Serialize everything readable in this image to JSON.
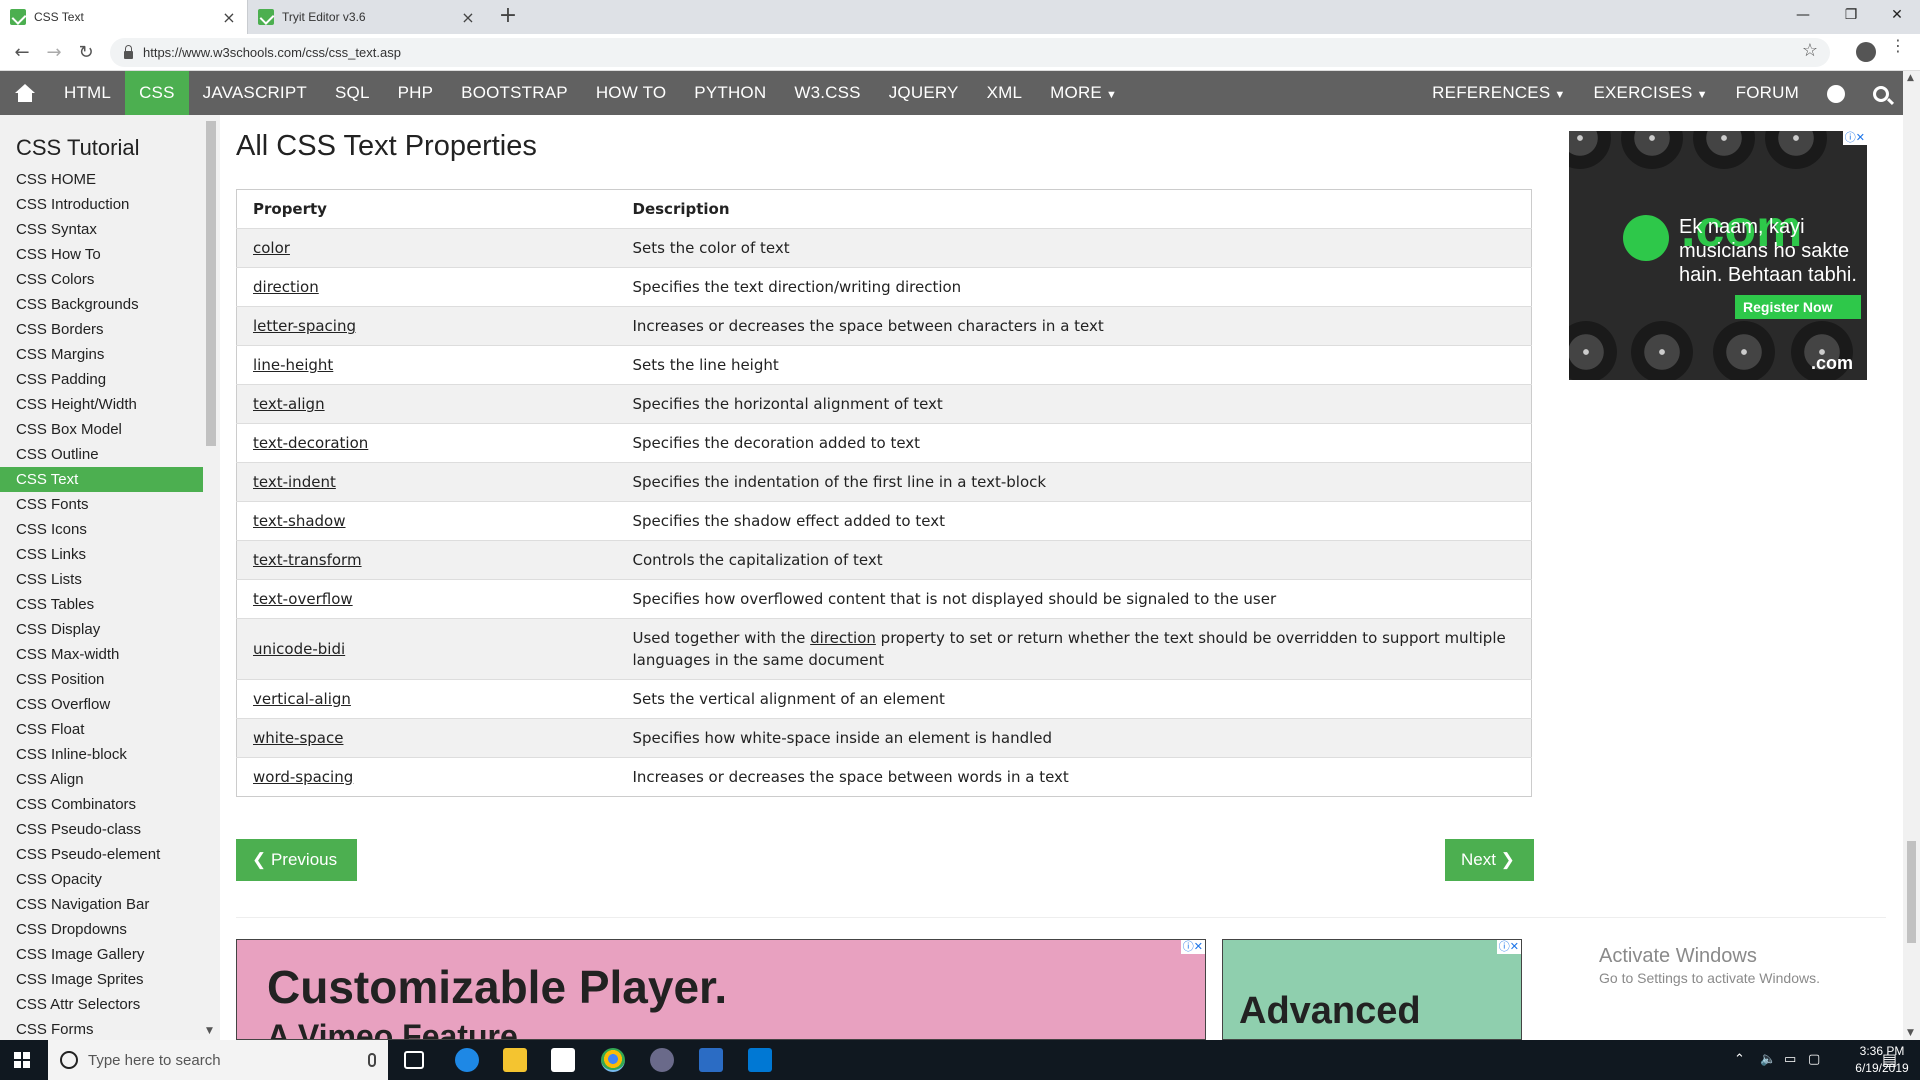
{
  "browser": {
    "tabs": [
      {
        "title": "CSS Text",
        "active": true
      },
      {
        "title": "Tryit Editor v3.6",
        "active": false
      }
    ],
    "url": "https://www.w3schools.com/css/css_text.asp"
  },
  "topnav": {
    "items": [
      "HTML",
      "CSS",
      "JAVASCRIPT",
      "SQL",
      "PHP",
      "BOOTSTRAP",
      "HOW TO",
      "PYTHON",
      "W3.CSS",
      "JQUERY",
      "XML",
      "MORE"
    ],
    "active": "CSS",
    "right_items": [
      "REFERENCES",
      "EXERCISES",
      "FORUM"
    ]
  },
  "sidebar": {
    "title": "CSS Tutorial",
    "items": [
      "CSS HOME",
      "CSS Introduction",
      "CSS Syntax",
      "CSS How To",
      "CSS Colors",
      "CSS Backgrounds",
      "CSS Borders",
      "CSS Margins",
      "CSS Padding",
      "CSS Height/Width",
      "CSS Box Model",
      "CSS Outline",
      "CSS Text",
      "CSS Fonts",
      "CSS Icons",
      "CSS Links",
      "CSS Lists",
      "CSS Tables",
      "CSS Display",
      "CSS Max-width",
      "CSS Position",
      "CSS Overflow",
      "CSS Float",
      "CSS Inline-block",
      "CSS Align",
      "CSS Combinators",
      "CSS Pseudo-class",
      "CSS Pseudo-element",
      "CSS Opacity",
      "CSS Navigation Bar",
      "CSS Dropdowns",
      "CSS Image Gallery",
      "CSS Image Sprites",
      "CSS Attr Selectors",
      "CSS Forms"
    ],
    "active": "CSS Text"
  },
  "main": {
    "heading": "All CSS Text Properties",
    "table": {
      "headers": [
        "Property",
        "Description"
      ],
      "rows": [
        {
          "property": "color",
          "description": "Sets the color of text"
        },
        {
          "property": "direction",
          "description": "Specifies the text direction/writing direction"
        },
        {
          "property": "letter-spacing",
          "description": "Increases or decreases the space between characters in a text"
        },
        {
          "property": "line-height",
          "description": "Sets the line height"
        },
        {
          "property": "text-align",
          "description": "Specifies the horizontal alignment of text"
        },
        {
          "property": "text-decoration",
          "description": "Specifies the decoration added to text"
        },
        {
          "property": "text-indent",
          "description": "Specifies the indentation of the first line in a text-block"
        },
        {
          "property": "text-shadow",
          "description": "Specifies the shadow effect added to text"
        },
        {
          "property": "text-transform",
          "description": "Controls the capitalization of text"
        },
        {
          "property": "text-overflow",
          "description": "Specifies how overflowed content that is not displayed should be signaled to the user"
        },
        {
          "property": "unicode-bidi",
          "description_pre": "Used together with the ",
          "description_link": "direction",
          "description_post": " property to set or return whether the text should be overridden to support multiple languages in the same document"
        },
        {
          "property": "vertical-align",
          "description": "Sets the vertical alignment of an element"
        },
        {
          "property": "white-space",
          "description": "Specifies how white-space inside an element is handled"
        },
        {
          "property": "word-spacing",
          "description": "Increases or decreases the space between words in a text"
        }
      ]
    },
    "prev_label": "❮ Previous",
    "next_label": "Next ❯"
  },
  "ads": {
    "banner1_line1": "Customizable Player.",
    "banner1_line2": "A Vimeo Feature",
    "banner2_line1": "Advanced",
    "side_brand": ".com",
    "side_copy": "Ek naam, kayi musicians ho sakte hain. Behtaan tabhi.",
    "side_cta": "Register Now",
    "side_footer": ".com"
  },
  "watermark": {
    "line1": "Activate Windows",
    "line2": "Go to Settings to activate Windows."
  },
  "taskbar": {
    "search_placeholder": "Type here to search",
    "time": "3:36 PM",
    "date": "6/19/2019"
  }
}
